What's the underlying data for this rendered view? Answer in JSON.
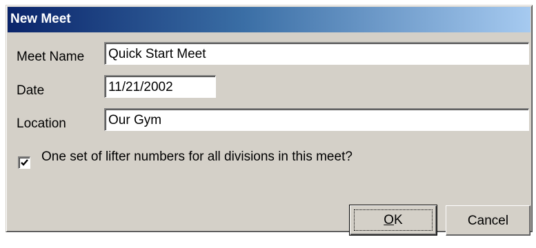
{
  "dialog": {
    "title": "New Meet"
  },
  "form": {
    "meet_name_label": "Meet Name",
    "meet_name_value": "Quick Start Meet",
    "date_label": "Date",
    "date_value": "11/21/2002",
    "location_label": "Location",
    "location_value": "Our Gym",
    "lifter_numbers_label": "One set of lifter numbers for all divisions in this meet?",
    "lifter_numbers_checked": true
  },
  "buttons": {
    "ok_mnemonic": "O",
    "ok_rest": "K",
    "cancel_label": "Cancel"
  },
  "colors": {
    "face": "#d4d0c8",
    "title_start": "#0a246a",
    "title_end": "#a6caf0"
  },
  "icons": {
    "checkbox_mark": "check-icon"
  }
}
